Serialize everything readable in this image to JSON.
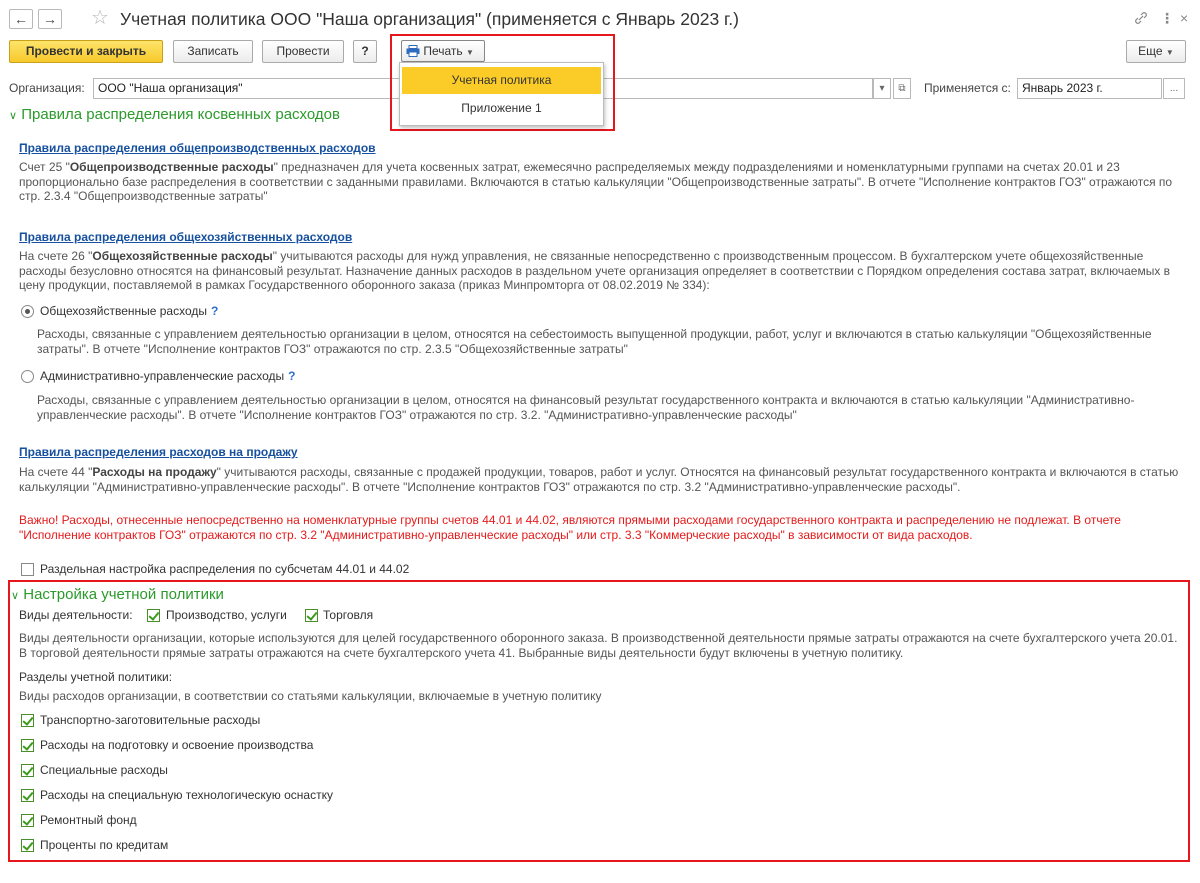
{
  "window": {
    "title": "Учетная политика ООО \"Наша организация\" (применяется с Январь 2023 г.)",
    "back_icon": "←",
    "forward_icon": "→",
    "star_icon": "☆",
    "link_icon": "🔗",
    "more_icon": "⋮",
    "close_icon": "×"
  },
  "toolbar": {
    "post_close": "Провести и закрыть",
    "save": "Записать",
    "post": "Провести",
    "help": "?",
    "print": "Печать",
    "more": "Еще"
  },
  "print_menu": {
    "items": [
      "Учетная политика",
      "Приложение 1"
    ],
    "selected": 0
  },
  "org_row": {
    "org_label": "Организация:",
    "org_value": "ООО \"Наша организация\"",
    "applies_label": "Применяется с:",
    "applies_value": "Январь 2023 г.",
    "ellipsis": "...",
    "dropdown_icon": "▾",
    "open_icon": "⧉"
  },
  "section1": {
    "title": "Правила распределения косвенных расходов",
    "rule1": {
      "link": "Правила распределения общепроизводственных расходов",
      "text_pre": "Счет 25 \"",
      "text_bold": "Общепроизводственные расходы",
      "text_post": "\" предназначен для учета косвенных затрат, ежемесячно распределяемых между подразделениями и номенклатурными группами на счетах 20.01 и 23 пропорционально базе распределения в соответствии с заданными правилами. Включаются в статью калькуляции \"Общепроизводственные затраты\". В отчете \"Исполнение контрактов ГОЗ\" отражаются по стр. 2.3.4 \"Общепроизводственные затраты\""
    },
    "rule2": {
      "link": "Правила распределения общехозяйственных расходов",
      "text_pre": "На счете 26 \"",
      "text_bold": "Общехозяйственные расходы",
      "text_post": "\" учитываются расходы для нужд управления, не связанные непосредственно с производственным процессом. В бухгалтерском учете общехозяйственные расходы безусловно относятся на финансовый результат. Назначение данных расходов в раздельном учете организация определяет в соответствии с Порядком определения состава затрат, включаемых в цену продукции, поставляемой в рамках Государственного оборонного заказа (приказ Минпромторга от 08.02.2019 № 334):",
      "option1_label": "Общехозяйственные расходы",
      "option1_desc": "Расходы, связанные с управлением деятельностью организации в целом, относятся на себестоимость выпущенной продукции, работ, услуг и включаются в статью калькуляции \"Общехозяйственные затраты\". В отчете \"Исполнение контрактов ГОЗ\" отражаются по стр. 2.3.5 \"Общехозяйственные затраты\"",
      "option2_label": "Административно-управленческие расходы",
      "option2_desc": "Расходы, связанные с управлением деятельностью организации в целом, относятся на финансовый результат государственного контракта и включаются в статью калькуляции \"Административно-управленческие расходы\". В отчете \"Исполнение контрактов ГОЗ\" отражаются по стр. 3.2. \"Административно-управленческие расходы\"",
      "help": "?"
    },
    "rule3": {
      "link": "Правила распределения расходов на продажу",
      "text_pre": "На счете 44 \"",
      "text_bold": "Расходы на продажу",
      "text_post": "\" учитываются расходы, связанные с продажей продукции, товаров, работ и услуг. Относятся на финансовый результат государственного контракта и включаются в статью калькуляции \"Административно-управленческие расходы\". В отчете \"Исполнение контрактов ГОЗ\" отражаются по стр. 3.2 \"Административно-управленческие расходы\"."
    },
    "warning": "Важно! Расходы, отнесенные непосредственно на номенклатурные группы счетов 44.01 и 44.02, являются прямыми расходами государственного контракта и распределению не подлежат. В отчете \"Исполнение контрактов ГОЗ\" отражаются по стр. 3.2 \"Административно-управленческие расходы\" или стр. 3.3 \"Коммерческие расходы\" в зависимости от вида расходов.",
    "separate_label": "Раздельная настройка распределения по субсчетам 44.01 и 44.02"
  },
  "section2": {
    "title": "Настройка учетной политики",
    "activity_label": "Виды деятельности:",
    "activity1": "Производство, услуги",
    "activity2": "Торговля",
    "activity_desc": "Виды деятельности организации, которые используются для целей государственного оборонного заказа. В производственной деятельности прямые затраты отражаются на счете бухгалтерского учета 20.01. В торговой деятельности прямые затраты отражаются на счете бухгалтерского учета 41. Выбранные виды деятельности будут включены в учетную политику.",
    "sections_label": "Разделы учетной политики:",
    "sections_desc": "Виды расходов организации, в соответствии со статьями калькуляции, включаемые в учетную политику",
    "items": [
      "Транспортно-заготовительные расходы",
      "Расходы на подготовку и освоение производства",
      "Специальные расходы",
      "Расходы на специальную технологическую оснастку",
      "Ремонтный фонд",
      "Проценты по кредитам"
    ]
  },
  "colors": {
    "accent_yellow": "#fbcc27",
    "section_green": "#2b9a2b",
    "link_blue": "#16509e",
    "warning_red": "#e51a1a",
    "highlight_red": "#e5161c"
  }
}
